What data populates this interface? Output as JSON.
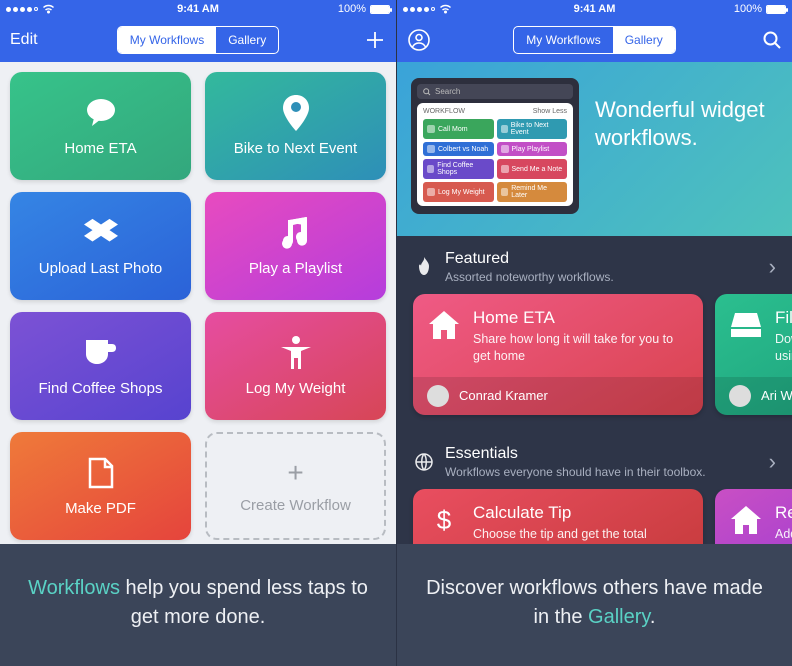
{
  "status": {
    "time": "9:41 AM",
    "battery": "100%",
    "carrier_wifi": true
  },
  "left": {
    "nav": {
      "edit": "Edit",
      "seg_my": "My Workflows",
      "seg_gallery": "Gallery",
      "active_segment": "My Workflows"
    },
    "tiles": [
      {
        "id": "home-eta",
        "label": "Home ETA",
        "icon": "speech",
        "grad": [
          "#37c38a",
          "#33a77d"
        ]
      },
      {
        "id": "bike",
        "label": "Bike to Next Event",
        "icon": "pin",
        "grad": [
          "#33b99c",
          "#2e8fb8"
        ]
      },
      {
        "id": "upload",
        "label": "Upload Last Photo",
        "icon": "dropbox",
        "grad": [
          "#3585e4",
          "#2b62d8"
        ]
      },
      {
        "id": "playlist",
        "label": "Play a Playlist",
        "icon": "music",
        "grad": [
          "#e84bbf",
          "#b53ddc"
        ]
      },
      {
        "id": "coffee",
        "label": "Find Coffee Shops",
        "icon": "cup",
        "grad": [
          "#7c52d5",
          "#5743cf"
        ]
      },
      {
        "id": "weight",
        "label": "Log My Weight",
        "icon": "body",
        "grad": [
          "#e64da1",
          "#d74656"
        ]
      },
      {
        "id": "pdf",
        "label": "Make PDF",
        "icon": "doc",
        "grad": [
          "#ef7a3a",
          "#e5443c"
        ]
      }
    ],
    "create": "Create Workflow",
    "caption_pre": "Workflows",
    "caption_rest": " help you spend less taps to get more done."
  },
  "right": {
    "nav": {
      "seg_my": "My Workflows",
      "seg_gallery": "Gallery",
      "active_segment": "Gallery"
    },
    "hero": {
      "title": "Wonderful widget workflows.",
      "search": "Search",
      "widget_title": "WORKFLOW",
      "widget_toggle": "Show Less",
      "widget_items": [
        {
          "label": "Call Mom",
          "color": "#3aa65c"
        },
        {
          "label": "Bike to Next Event",
          "color": "#2f9ab1"
        },
        {
          "label": "Colbert vs Noah",
          "color": "#2f6fd6"
        },
        {
          "label": "Play Playlist",
          "color": "#c24fc6"
        },
        {
          "label": "Find Coffee Shops",
          "color": "#6a4ac9"
        },
        {
          "label": "Send Me a Note",
          "color": "#d7475f"
        },
        {
          "label": "Log My Weight",
          "color": "#d75a4f"
        },
        {
          "label": "Remind Me Later",
          "color": "#d58a3d"
        }
      ]
    },
    "featured": {
      "title": "Featured",
      "sub": "Assorted noteworthy workflows.",
      "cards": [
        {
          "title": "Home ETA",
          "sub": "Share how long it will take for you to get home",
          "author": "Conrad Kramer",
          "grad": [
            "#ef5a85",
            "#d9434e"
          ],
          "icon": "house"
        },
        {
          "title": "File D",
          "sub": "Downl\nusing a",
          "author": "Ari We",
          "grad": [
            "#2bbf8f",
            "#1ea37d"
          ],
          "icon": "drive"
        }
      ]
    },
    "essentials": {
      "title": "Essentials",
      "sub": "Workflows everyone should have in their toolbox.",
      "cards": [
        {
          "title": "Calculate Tip",
          "sub": "Choose the tip and get the total",
          "grad": [
            "#e94e60",
            "#c83c3e"
          ],
          "icon": "dollar"
        },
        {
          "title": "Remi",
          "sub": "Add a r",
          "grad": [
            "#c94fc4",
            "#a33fd1"
          ],
          "icon": "house"
        }
      ]
    },
    "caption_pre": "Discover workflows others have made in the ",
    "caption_hi": "Gallery",
    "caption_post": "."
  }
}
